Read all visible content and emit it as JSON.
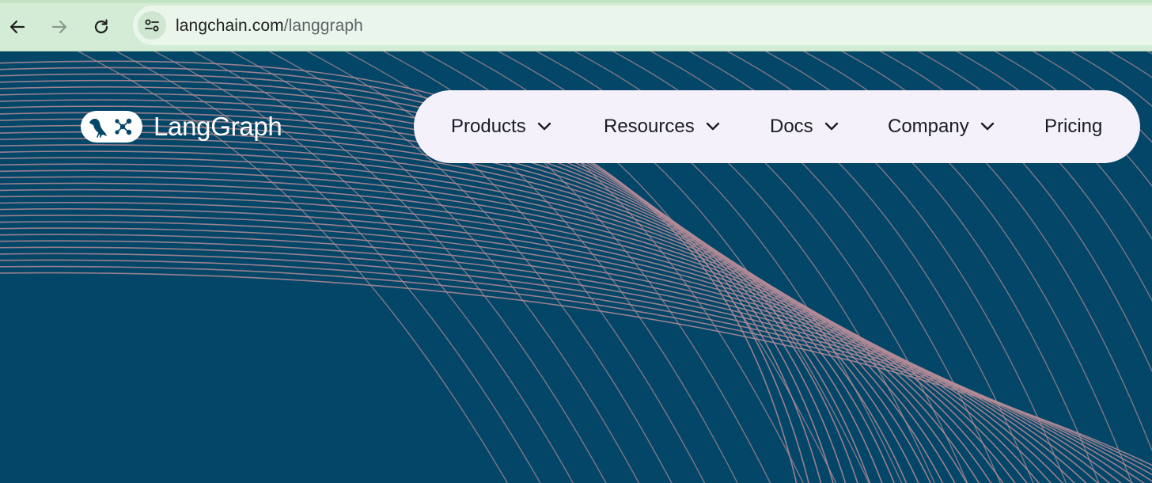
{
  "browser": {
    "url_domain": "langchain.com",
    "url_path": "/langgraph",
    "icons": {
      "back": "arrow-left-icon",
      "forward": "arrow-right-icon",
      "reload": "reload-icon",
      "site_info": "tune-icon"
    }
  },
  "header": {
    "logo_text": "LangGraph",
    "logo_icon": "parrot-graph-logo"
  },
  "nav": {
    "items": [
      {
        "label": "Products",
        "has_dropdown": true
      },
      {
        "label": "Resources",
        "has_dropdown": true
      },
      {
        "label": "Docs",
        "has_dropdown": true
      },
      {
        "label": "Company",
        "has_dropdown": true
      },
      {
        "label": "Pricing",
        "has_dropdown": false
      }
    ]
  },
  "colors": {
    "page_background": "#034667",
    "nav_pill": "#f4f1fb",
    "chrome": "#d4ecd6",
    "line_stroke": "#b48b96"
  }
}
